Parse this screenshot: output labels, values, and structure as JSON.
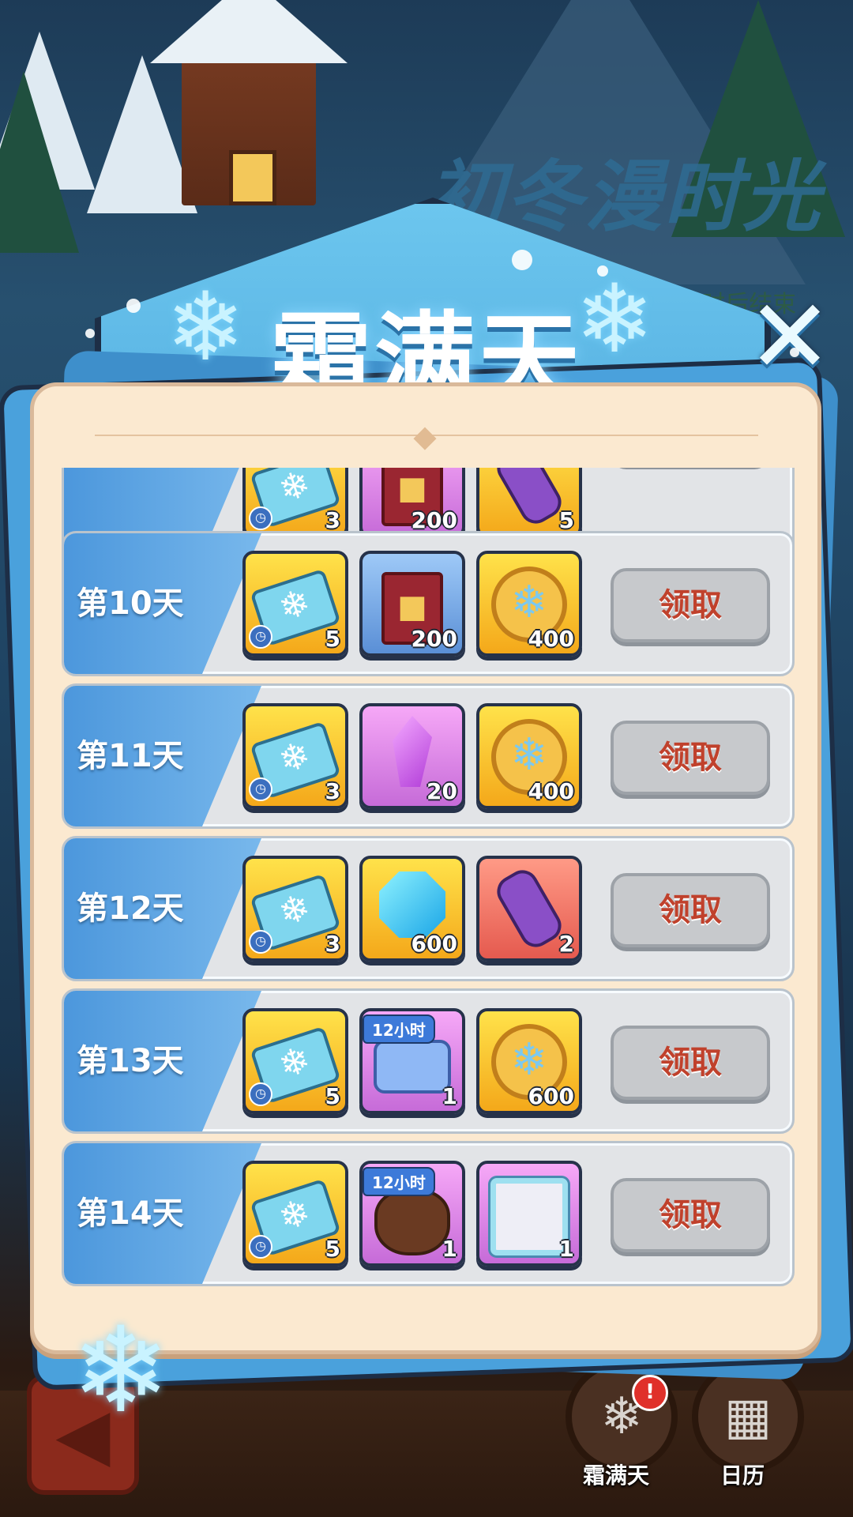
{
  "background": {
    "event_banner_title": "初冬漫时光",
    "event_banner_subtitle": "23小时后结束"
  },
  "popup": {
    "title": "霜满天",
    "close_glyph": "✕"
  },
  "rows": [
    {
      "day": "",
      "partial": true,
      "items": [
        {
          "icon": "snow-ticket-icon",
          "color": "yellow",
          "qty": "3",
          "timer": true
        },
        {
          "icon": "book-icon",
          "color": "purple",
          "qty": "200"
        },
        {
          "icon": "scroll-icon",
          "color": "yellow",
          "qty": "5"
        }
      ],
      "claim_label": ""
    },
    {
      "day": "第10天",
      "items": [
        {
          "icon": "snow-ticket-icon",
          "color": "yellow",
          "qty": "5",
          "timer": true
        },
        {
          "icon": "book-icon",
          "color": "blue",
          "qty": "200"
        },
        {
          "icon": "snow-coin-icon",
          "color": "yellow",
          "qty": "400"
        }
      ],
      "claim_label": "领取"
    },
    {
      "day": "第11天",
      "items": [
        {
          "icon": "snow-ticket-icon",
          "color": "yellow",
          "qty": "3",
          "timer": true
        },
        {
          "icon": "crystal-icon",
          "color": "purple",
          "qty": "20"
        },
        {
          "icon": "snow-coin-icon",
          "color": "yellow",
          "qty": "400"
        }
      ],
      "claim_label": "领取"
    },
    {
      "day": "第12天",
      "items": [
        {
          "icon": "snow-ticket-icon",
          "color": "yellow",
          "qty": "3",
          "timer": true
        },
        {
          "icon": "blue-gem-icon",
          "color": "yellow",
          "qty": "600"
        },
        {
          "icon": "scroll-icon",
          "color": "red",
          "qty": "2"
        }
      ],
      "claim_label": "领取"
    },
    {
      "day": "第13天",
      "items": [
        {
          "icon": "snow-ticket-icon",
          "color": "yellow",
          "qty": "5",
          "timer": true
        },
        {
          "icon": "ice-cubes-icon",
          "color": "purple",
          "qty": "1",
          "tag": "12小时"
        },
        {
          "icon": "snow-coin-icon",
          "color": "yellow",
          "qty": "600"
        }
      ],
      "claim_label": "领取"
    },
    {
      "day": "第14天",
      "items": [
        {
          "icon": "snow-ticket-icon",
          "color": "yellow",
          "qty": "5",
          "timer": true
        },
        {
          "icon": "gem-sack-icon",
          "color": "purple",
          "qty": "1",
          "tag": "12小时"
        },
        {
          "icon": "avatar-frame-icon",
          "color": "purple",
          "qty": "1"
        }
      ],
      "claim_label": "领取"
    }
  ],
  "dock": {
    "frost_label": "霜满天",
    "calendar_label": "日历",
    "alert_glyph": "!"
  }
}
